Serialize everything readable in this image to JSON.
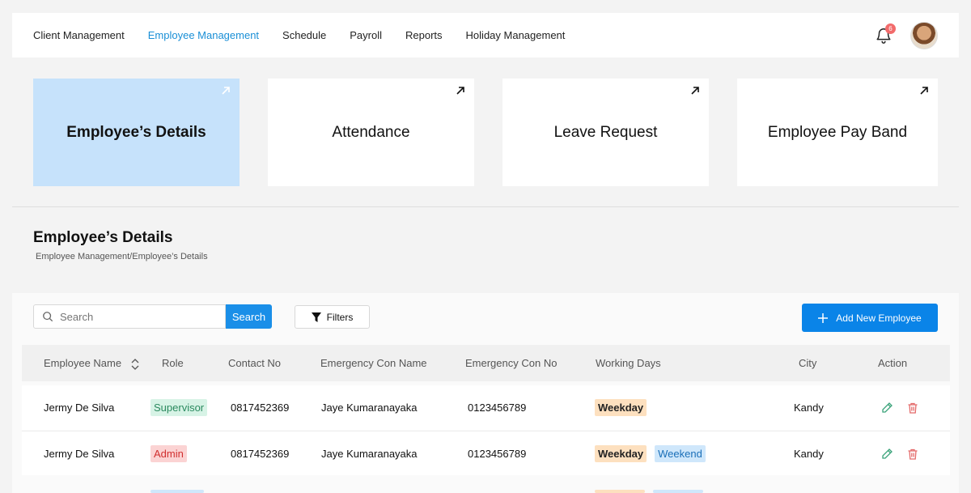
{
  "nav": {
    "items": [
      "Client Management",
      "Employee Management",
      "Schedule",
      "Payroll",
      "Reports",
      "Holiday Management"
    ],
    "active": "Employee Management",
    "notification_count": "6"
  },
  "cards": [
    {
      "title": "Employee’s Details",
      "active": true
    },
    {
      "title": "Attendance",
      "active": false
    },
    {
      "title": "Leave Request",
      "active": false
    },
    {
      "title": "Employee Pay Band",
      "active": false
    }
  ],
  "page": {
    "title": "Employee’s Details",
    "breadcrumb": "Employee Management/Employee’s Details"
  },
  "toolbar": {
    "search_placeholder": "Search",
    "search_label": "Search",
    "filters_label": "Filters",
    "add_label": "Add New Employee"
  },
  "table": {
    "columns": [
      "Employee Name",
      "Role",
      "Contact No",
      "Emergency Con Name",
      "Emergency Con No",
      "Working Days",
      "City",
      "Action"
    ],
    "rows": [
      {
        "name": "Jermy De Silva",
        "role": "Supervisor",
        "contact": "0817452369",
        "emg_name": "Jaye Kumaranayaka",
        "emg_no": "0123456789",
        "days": [
          "Weekday"
        ],
        "city": "Kandy"
      },
      {
        "name": "Jermy De Silva",
        "role": "Admin",
        "contact": "0817452369",
        "emg_name": "Jaye Kumaranayaka",
        "emg_no": "0123456789",
        "days": [
          "Weekday",
          "Weekend"
        ],
        "city": "Kandy"
      }
    ]
  },
  "colors": {
    "accent": "#1a8fd6",
    "primary_button": "#0a84e8",
    "active_card": "#c6e2fb",
    "supervisor_bg": "#d7f3e6",
    "admin_bg": "#fbd3d3",
    "weekday_bg": "#fde0bf",
    "weekend_bg": "#cfe7fb"
  }
}
